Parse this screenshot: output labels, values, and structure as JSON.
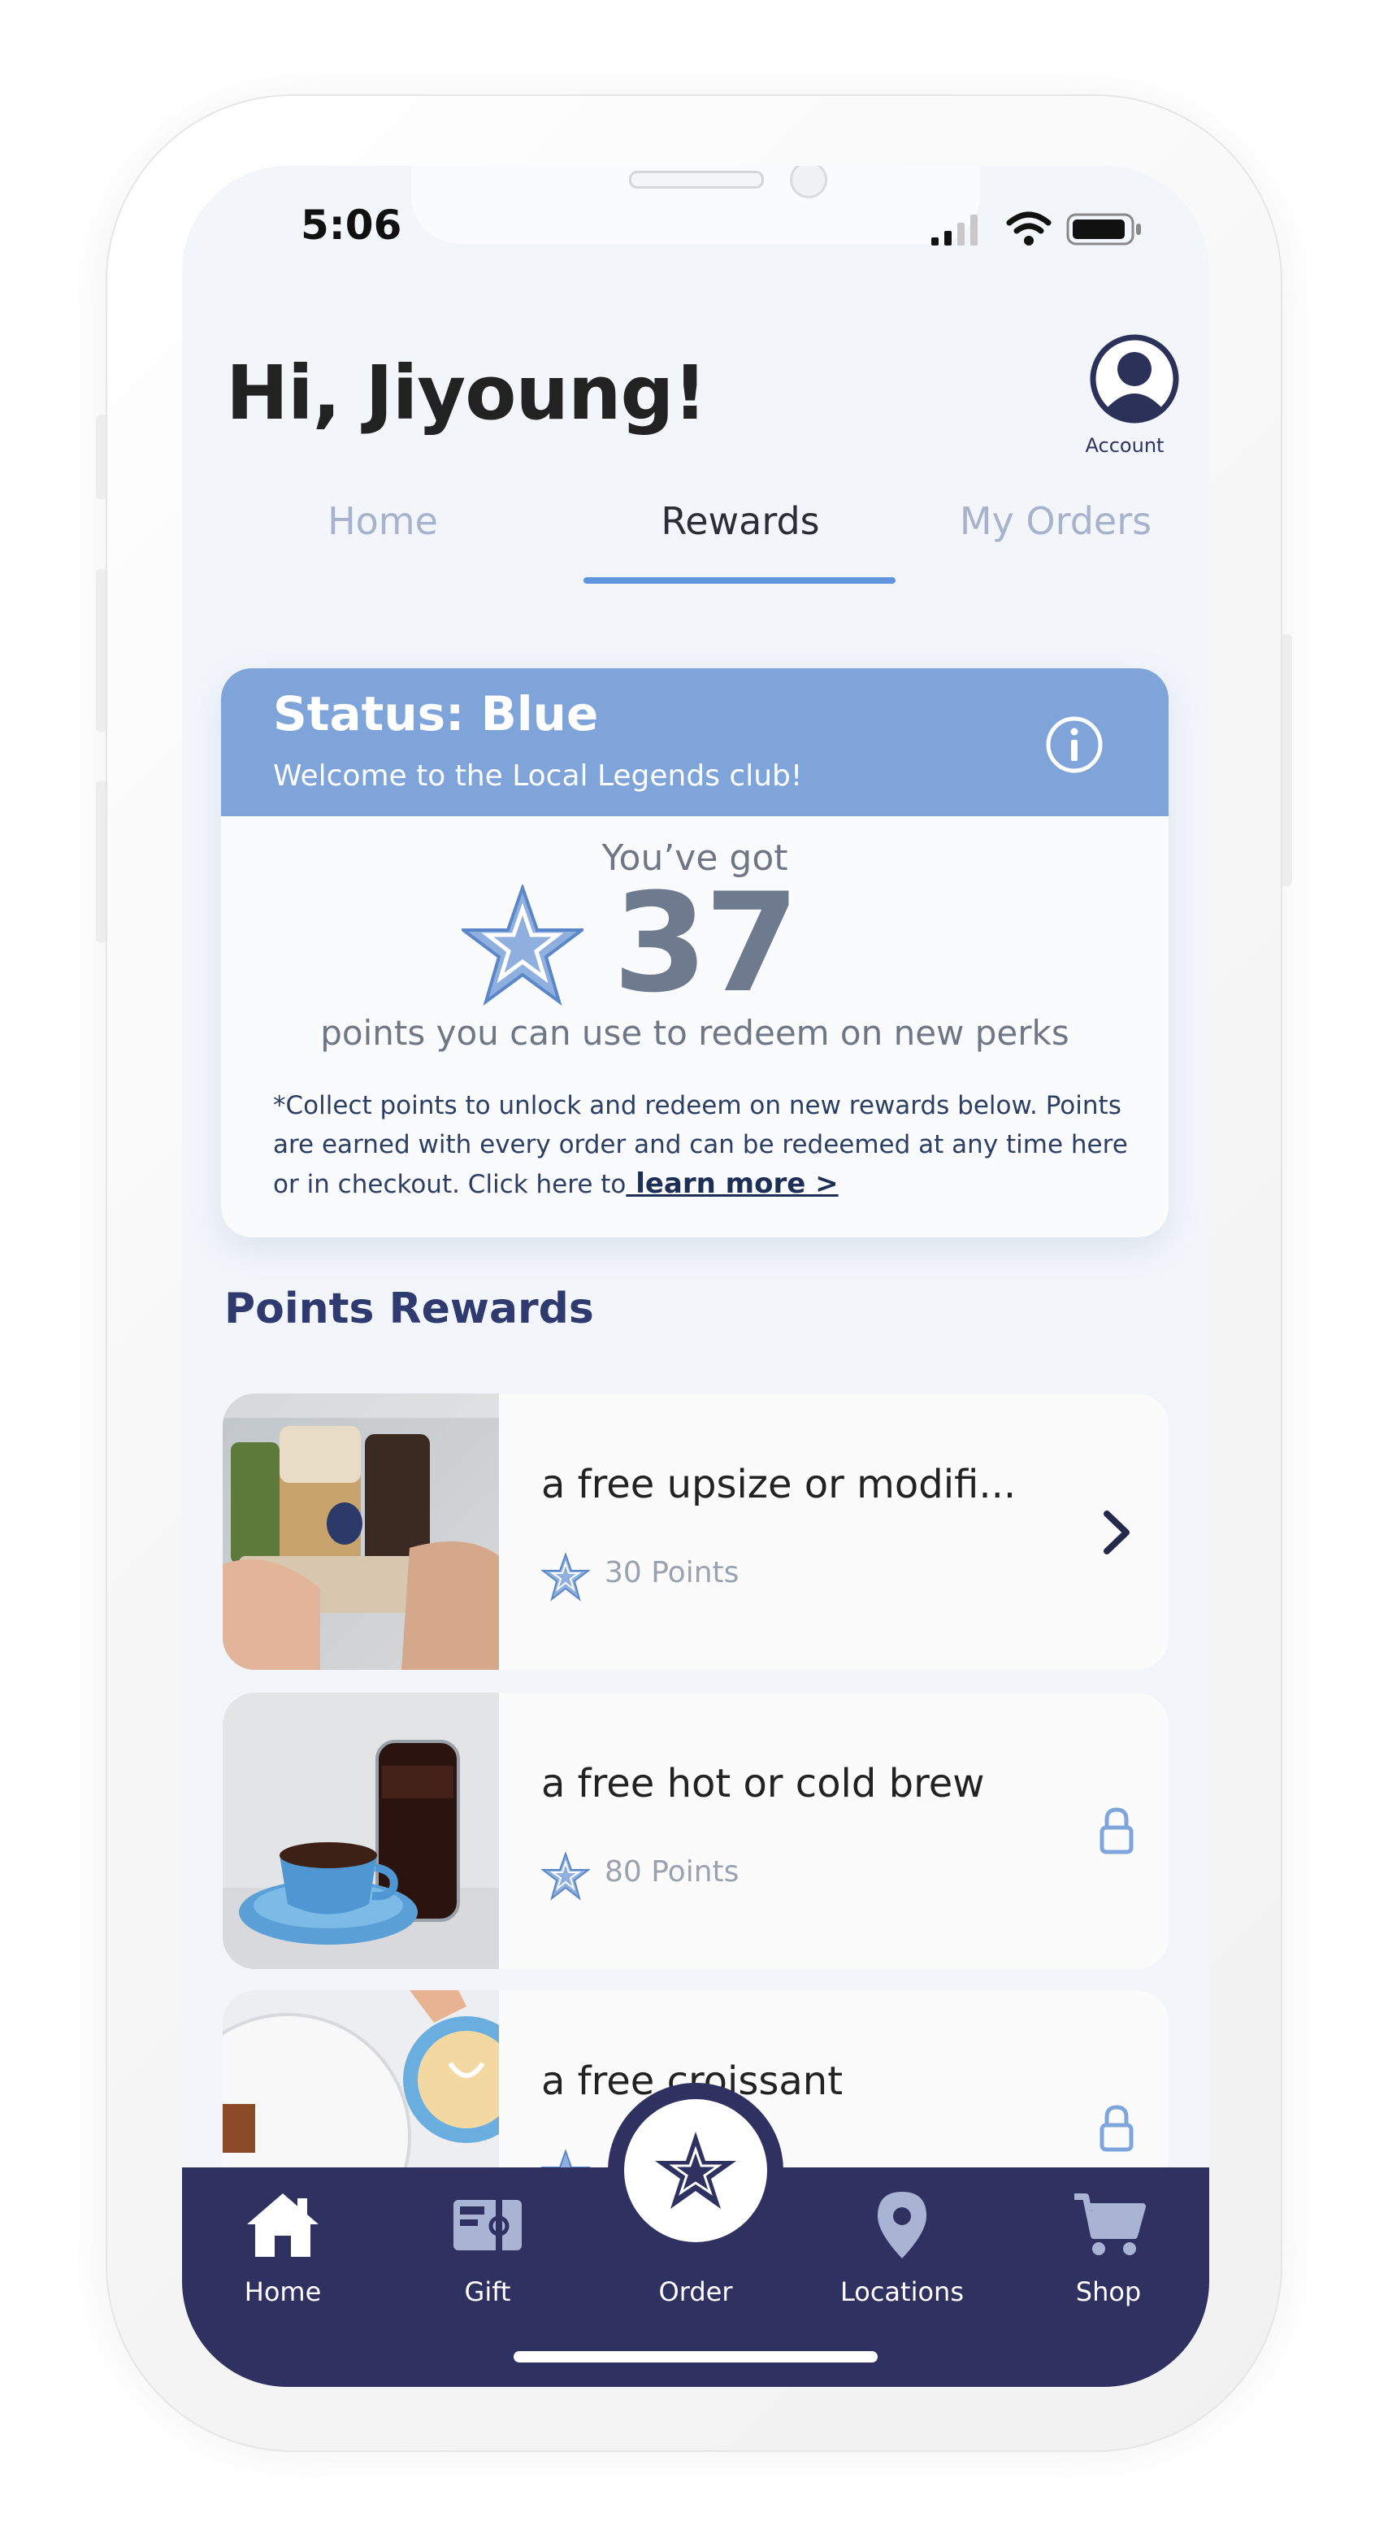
{
  "status_bar": {
    "time": "5:06",
    "icons": [
      "cellular-signal-icon",
      "wifi-icon",
      "battery-icon"
    ]
  },
  "header": {
    "greeting": "Hi, Jiyoung!",
    "account_label": "Account"
  },
  "tabs": [
    {
      "label": "Home",
      "active": false
    },
    {
      "label": "Rewards",
      "active": true
    },
    {
      "label": "My Orders",
      "active": false
    }
  ],
  "status_card": {
    "title": "Status: Blue",
    "subtitle": "Welcome to the Local Legends club!",
    "got_label": "You’ve got",
    "points": "37",
    "points_desc": "points you can use to redeem on new perks",
    "note": "*Collect points to unlock and redeem on new rewards below. Points are earned with every order and can be redeemed at any time here or in checkout. Click here to",
    "learn_more": " learn more >"
  },
  "rewards_section": {
    "title": "Points Rewards",
    "items": [
      {
        "title": "a free upsize or modifi...",
        "points": "30 Points",
        "state": "unlocked",
        "action_icon": "chevron-right-icon"
      },
      {
        "title": "a free hot or cold brew",
        "points": "80 Points",
        "state": "locked",
        "action_icon": "lock-icon"
      },
      {
        "title": "a free croissant",
        "points": "",
        "state": "locked",
        "action_icon": "lock-icon"
      }
    ]
  },
  "bottom_nav": {
    "items": [
      {
        "label": "Home",
        "icon": "home-icon"
      },
      {
        "label": "Gift",
        "icon": "gift-card-icon"
      },
      {
        "label": "Order",
        "icon": "star-icon"
      },
      {
        "label": "Locations",
        "icon": "location-pin-icon"
      },
      {
        "label": "Shop",
        "icon": "cart-icon"
      }
    ]
  },
  "colors": {
    "accent": "#7ea4d9",
    "tab_underline": "#5f95dc",
    "nav_background": "#2f3260",
    "section_title": "#2f3b6e"
  }
}
